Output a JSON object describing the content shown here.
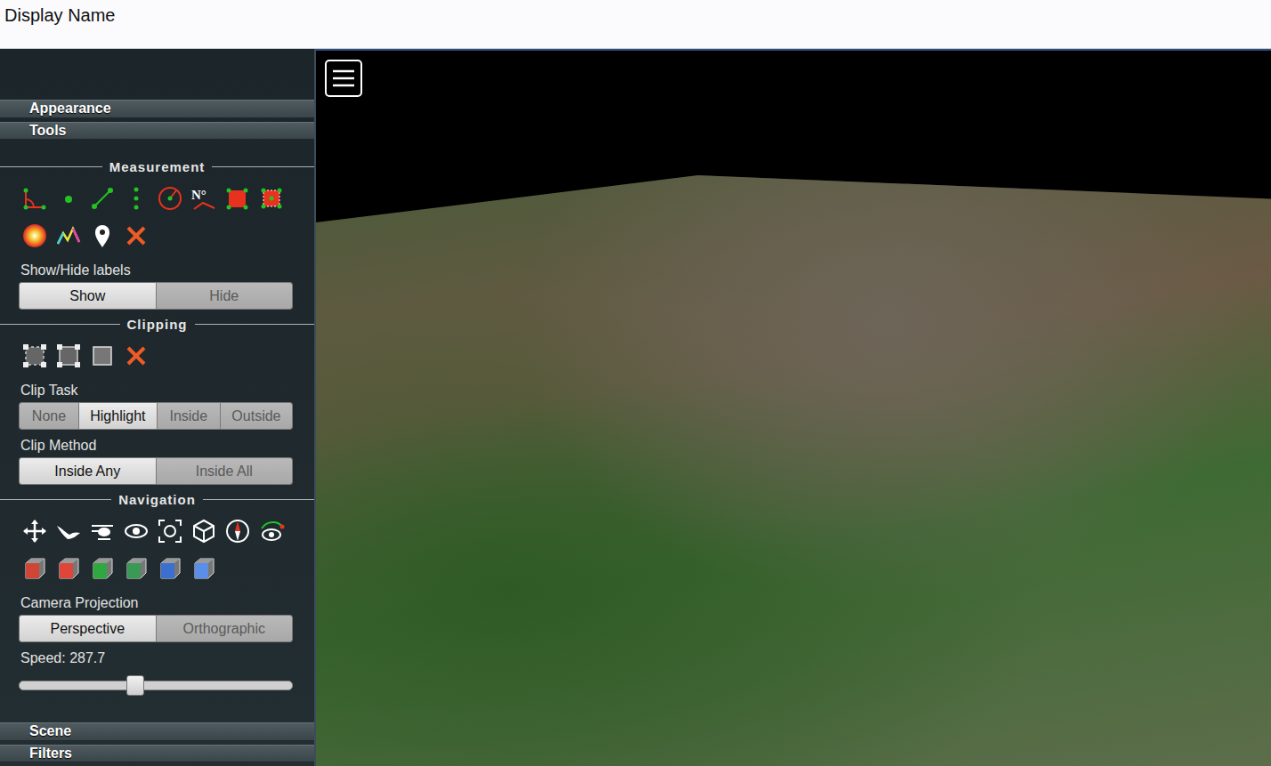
{
  "header": {
    "title": "Display Name"
  },
  "sidebar": {
    "top_sections": [
      {
        "label": "Appearance",
        "expanded": false
      },
      {
        "label": "Tools",
        "expanded": true
      }
    ],
    "tools": {
      "measurement": {
        "title": "Measurement",
        "azimuth_label": "N°",
        "labels_title": "Show/Hide labels",
        "labels_options": [
          {
            "label": "Show",
            "selected": true
          },
          {
            "label": "Hide",
            "selected": false
          }
        ]
      },
      "clipping": {
        "title": "Clipping",
        "task_title": "Clip Task",
        "task_options": [
          {
            "label": "None",
            "selected": false
          },
          {
            "label": "Highlight",
            "selected": true
          },
          {
            "label": "Inside",
            "selected": false
          },
          {
            "label": "Outside",
            "selected": false
          }
        ],
        "method_title": "Clip Method",
        "method_options": [
          {
            "label": "Inside Any",
            "selected": true
          },
          {
            "label": "Inside All",
            "selected": false
          }
        ]
      },
      "navigation": {
        "title": "Navigation",
        "projection_title": "Camera Projection",
        "projection_options": [
          {
            "label": "Perspective",
            "selected": true
          },
          {
            "label": "Orthographic",
            "selected": false
          }
        ],
        "speed": {
          "label": "Speed: 287.7",
          "level": 0.42
        }
      }
    },
    "bottom_sections": [
      {
        "label": "Scene",
        "expanded": false
      },
      {
        "label": "Filters",
        "expanded": false
      }
    ]
  }
}
